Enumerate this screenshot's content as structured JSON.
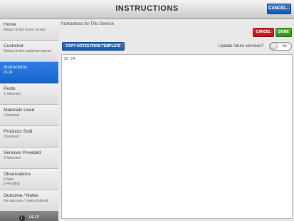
{
  "header": {
    "title": "INSTRUCTIONS",
    "cancel_label": "CANCEL..."
  },
  "sidebar": {
    "items": [
      {
        "label": "Home",
        "sub": "Return to the home screen"
      },
      {
        "label": "Customer",
        "sub": "Return to the customer screen"
      },
      {
        "label": "Instructions",
        "sub": "26  24"
      },
      {
        "label": "Pests",
        "sub": "1 Selected"
      },
      {
        "label": "Materials Used",
        "sub": "0 Entered"
      },
      {
        "label": "Products Sold",
        "sub": "0 Entered"
      },
      {
        "label": "Services Provided",
        "sub": "0 Selected"
      },
      {
        "label": "Observations",
        "sub": "0 New",
        "sub2": "1 Pending"
      },
      {
        "label": "Outcome / Notes",
        "sub": "No outcome / notes Entered"
      }
    ],
    "help_label": "HELP",
    "help_icon": "i"
  },
  "main": {
    "heading": "Instructions for This Service",
    "cancel_label": "CANCEL",
    "done_label": "DONE",
    "copy_label": "COPY NOTES FROM TEMPLATE",
    "update_label": "Update future services?",
    "toggle_label": "No",
    "notes_value": "26  24"
  },
  "colors": {
    "active_blue": "#1865cc",
    "cancel_red": "#c41f1f",
    "done_green": "#3f9a20"
  }
}
